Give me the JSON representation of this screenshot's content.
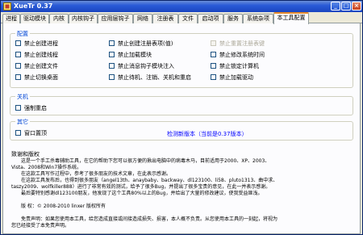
{
  "window": {
    "title": "XueTr 0.37"
  },
  "tabs": [
    {
      "label": "进程"
    },
    {
      "label": "驱动模块"
    },
    {
      "label": "内核"
    },
    {
      "label": "内核钩子"
    },
    {
      "label": "应用层钩子"
    },
    {
      "label": "网络"
    },
    {
      "label": "注册表"
    },
    {
      "label": "文件"
    },
    {
      "label": "启动项"
    },
    {
      "label": "服务"
    },
    {
      "label": "系统杂项"
    },
    {
      "label": "本工具配置"
    }
  ],
  "config": {
    "title": "配置",
    "col1": [
      "禁止创建进程",
      "禁止创建线程",
      "禁止创建文件",
      "禁止切换桌面"
    ],
    "col2": [
      "禁止创建注册表项(值)",
      "禁止加载模块",
      "禁止消息钩子模块注入",
      "禁止待机、注销、关机和重启"
    ],
    "col3": [
      "禁止重置注册表键",
      "禁止修改系统时间",
      "禁止锁定计算机",
      "禁止加载驱动"
    ]
  },
  "shutdown": {
    "title": "关机",
    "option": "强制重启"
  },
  "other": {
    "title": "其它",
    "option": "窗口置顶",
    "check_update": "检测新版本（当前是0.37版本）"
  },
  "about": {
    "title": "致谢和版权",
    "lines": [
      "这是一个手工杀毒辅助工具，在它的帮助下您可以很方便的揪出电脑中的病毒木马，目前适用于2000、XP、2003、",
      "Vista、2008和Win7操作系统。",
      "在这款工具写作过程中，参考了很多朋友的技术文章，在此表示感谢。",
      "在这款工具发布后，也得到很多朋友（angel13th、anaybaby、backway、dl123100、li58、pluto1313、曲中求、",
      "taszy2009、wolfkiller888）进行了非常有效的测试，给予了很多Bug，并提出了很多宝贵的意见，在此一并表示感谢。",
      "最后要特别感谢dl123100朋友，他发现了这个工具80%以上的Bug，并给出了大量的修改建议，使我受益匪浅。",
      "",
      "版    权：© 2008-2010 linxer  版权所有",
      "",
      "免责声明：如果您使用本工具，给您造成直接或间接造成损失、损害，本人概不负责。从您使用本工具的一刻起，将视为",
      "您已经接受了本免责声明。"
    ]
  }
}
